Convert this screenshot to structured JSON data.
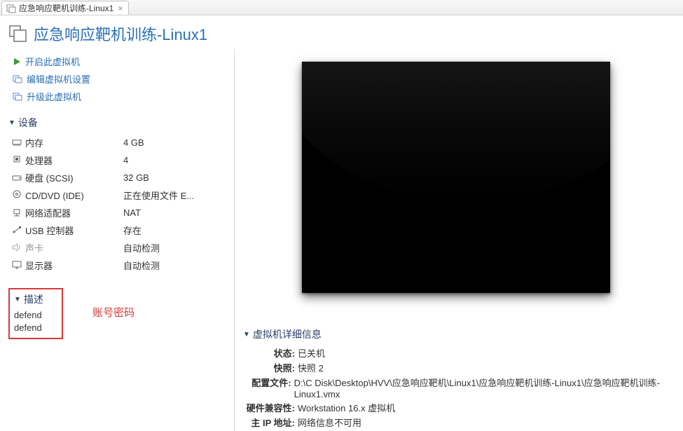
{
  "tab": {
    "label": "应急响应靶机训练-Linux1"
  },
  "title": "应急响应靶机训练-Linux1",
  "actions": {
    "power_on": "开启此虚拟机",
    "edit_settings": "编辑虚拟机设置",
    "upgrade": "升级此虚拟机"
  },
  "devices": {
    "heading": "设备",
    "rows": [
      {
        "icon": "memory-icon",
        "label": "内存",
        "value": "4 GB"
      },
      {
        "icon": "cpu-icon",
        "label": "处理器",
        "value": "4"
      },
      {
        "icon": "disk-icon",
        "label": "硬盘 (SCSI)",
        "value": "32 GB"
      },
      {
        "icon": "cd-icon",
        "label": "CD/DVD (IDE)",
        "value": "正在使用文件 E..."
      },
      {
        "icon": "network-icon",
        "label": "网络适配器",
        "value": "NAT"
      },
      {
        "icon": "usb-icon",
        "label": "USB 控制器",
        "value": "存在"
      },
      {
        "icon": "sound-icon",
        "label": "声卡",
        "value": "自动检测"
      },
      {
        "icon": "display-icon",
        "label": "显示器",
        "value": "自动检测"
      }
    ]
  },
  "description": {
    "heading": "描述",
    "line1": "defend",
    "line2": "defend",
    "annotation": "账号密码"
  },
  "details": {
    "heading": "虚拟机详细信息",
    "rows": [
      {
        "key": "状态:",
        "value": "已关机"
      },
      {
        "key": "快照:",
        "value": "快照 2"
      },
      {
        "key": "配置文件:",
        "value": "D:\\C Disk\\Desktop\\HVV\\应急响应靶机\\Linux1\\应急响应靶机训练-Linux1\\应急响应靶机训练-Linux1.vmx"
      },
      {
        "key": "硬件兼容性:",
        "value": "Workstation 16.x 虚拟机"
      },
      {
        "key": "主 IP 地址:",
        "value": "网络信息不可用"
      }
    ]
  }
}
